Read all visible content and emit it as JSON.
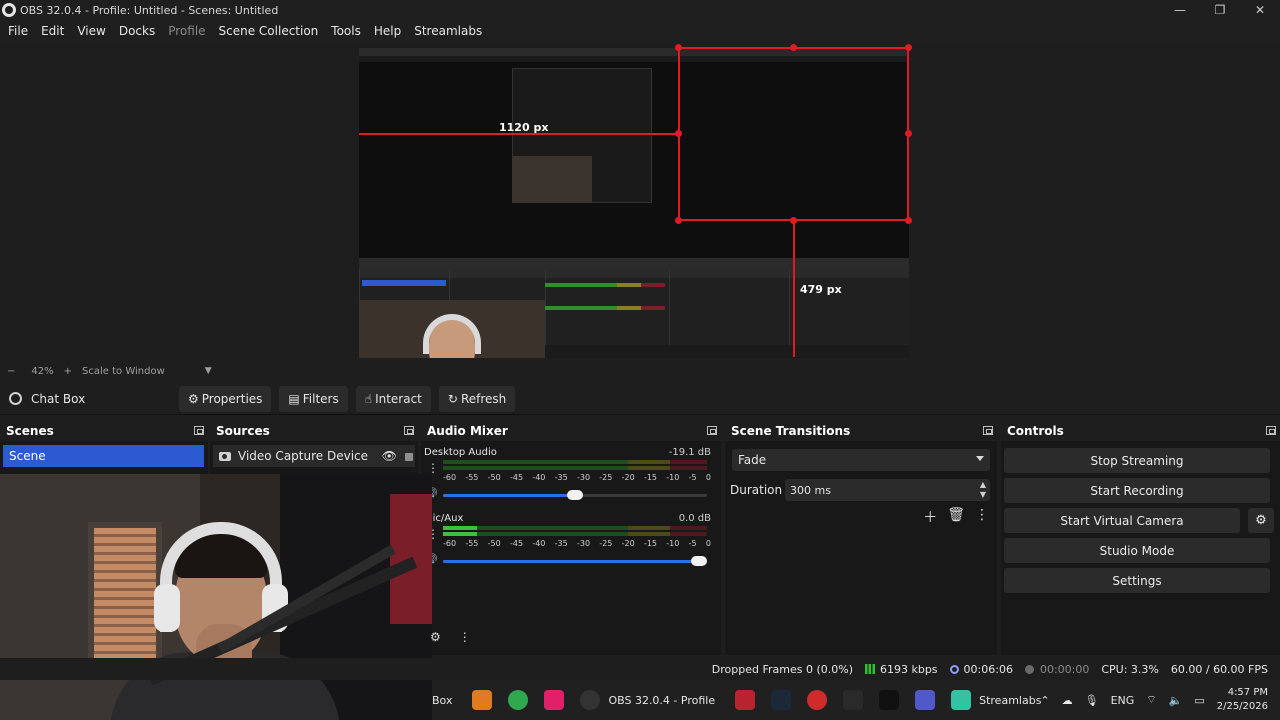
{
  "window": {
    "title": "OBS 32.0.4 - Profile: Untitled - Scenes: Untitled",
    "controls": [
      "—",
      "❐",
      "✕"
    ]
  },
  "menu": [
    "File",
    "Edit",
    "View",
    "Docks",
    "Profile",
    "Scene Collection",
    "Tools",
    "Help",
    "Streamlabs"
  ],
  "preview": {
    "width_label": "1120 px",
    "height_label": "479 px"
  },
  "zoom": {
    "minus": "−",
    "value": "42%",
    "plus": "+",
    "mode": "Scale to Window"
  },
  "source_toolbar": {
    "selected_source": "Chat Box",
    "buttons": {
      "properties": "Properties",
      "filters": "Filters",
      "interact": "Interact",
      "refresh": "Refresh"
    }
  },
  "scenes": {
    "title": "Scenes",
    "items": [
      "Scene"
    ]
  },
  "sources": {
    "title": "Sources",
    "items": [
      "Video Capture Device"
    ]
  },
  "audio_mixer": {
    "title": "Audio Mixer",
    "channels": [
      {
        "name": "Desktop Audio",
        "db": "-19.1 dB",
        "level": 0.0,
        "volume": 0.5
      },
      {
        "name": "Mic/Aux",
        "db": "0.0 dB",
        "level": 0.13,
        "volume": 0.97
      }
    ],
    "ticks": [
      "-60",
      "-55",
      "-50",
      "-45",
      "-40",
      "-35",
      "-30",
      "-25",
      "-20",
      "-15",
      "-10",
      "-5",
      "0"
    ]
  },
  "scene_transitions": {
    "title": "Scene Transitions",
    "selected": "Fade",
    "duration_label": "Duration",
    "duration_value": "300 ms"
  },
  "controls": {
    "title": "Controls",
    "buttons": {
      "stop_streaming": "Stop Streaming",
      "start_recording": "Start Recording",
      "start_virtual_camera": "Start Virtual Camera",
      "studio_mode": "Studio Mode",
      "settings": "Settings"
    }
  },
  "status": {
    "dropped_frames": "Dropped Frames 0 (0.0%)",
    "bitrate": "6193 kbps",
    "stream_time": "00:06:06",
    "rec_time": "00:00:00",
    "cpu": "CPU: 3.3%",
    "fps": "60.00 / 60.00 FPS"
  },
  "taskbar": {
    "clipped_label": "Box",
    "obs_label": "OBS 32.0.4 - Profile",
    "streamlabs_label": "Streamlabs",
    "language": "ENG",
    "time": "4:57 PM",
    "date": "2/25/2026"
  },
  "colors": {
    "accent": "#2c5bd1",
    "guide": "#e01b24",
    "meter_green": "#3fbf3f"
  }
}
